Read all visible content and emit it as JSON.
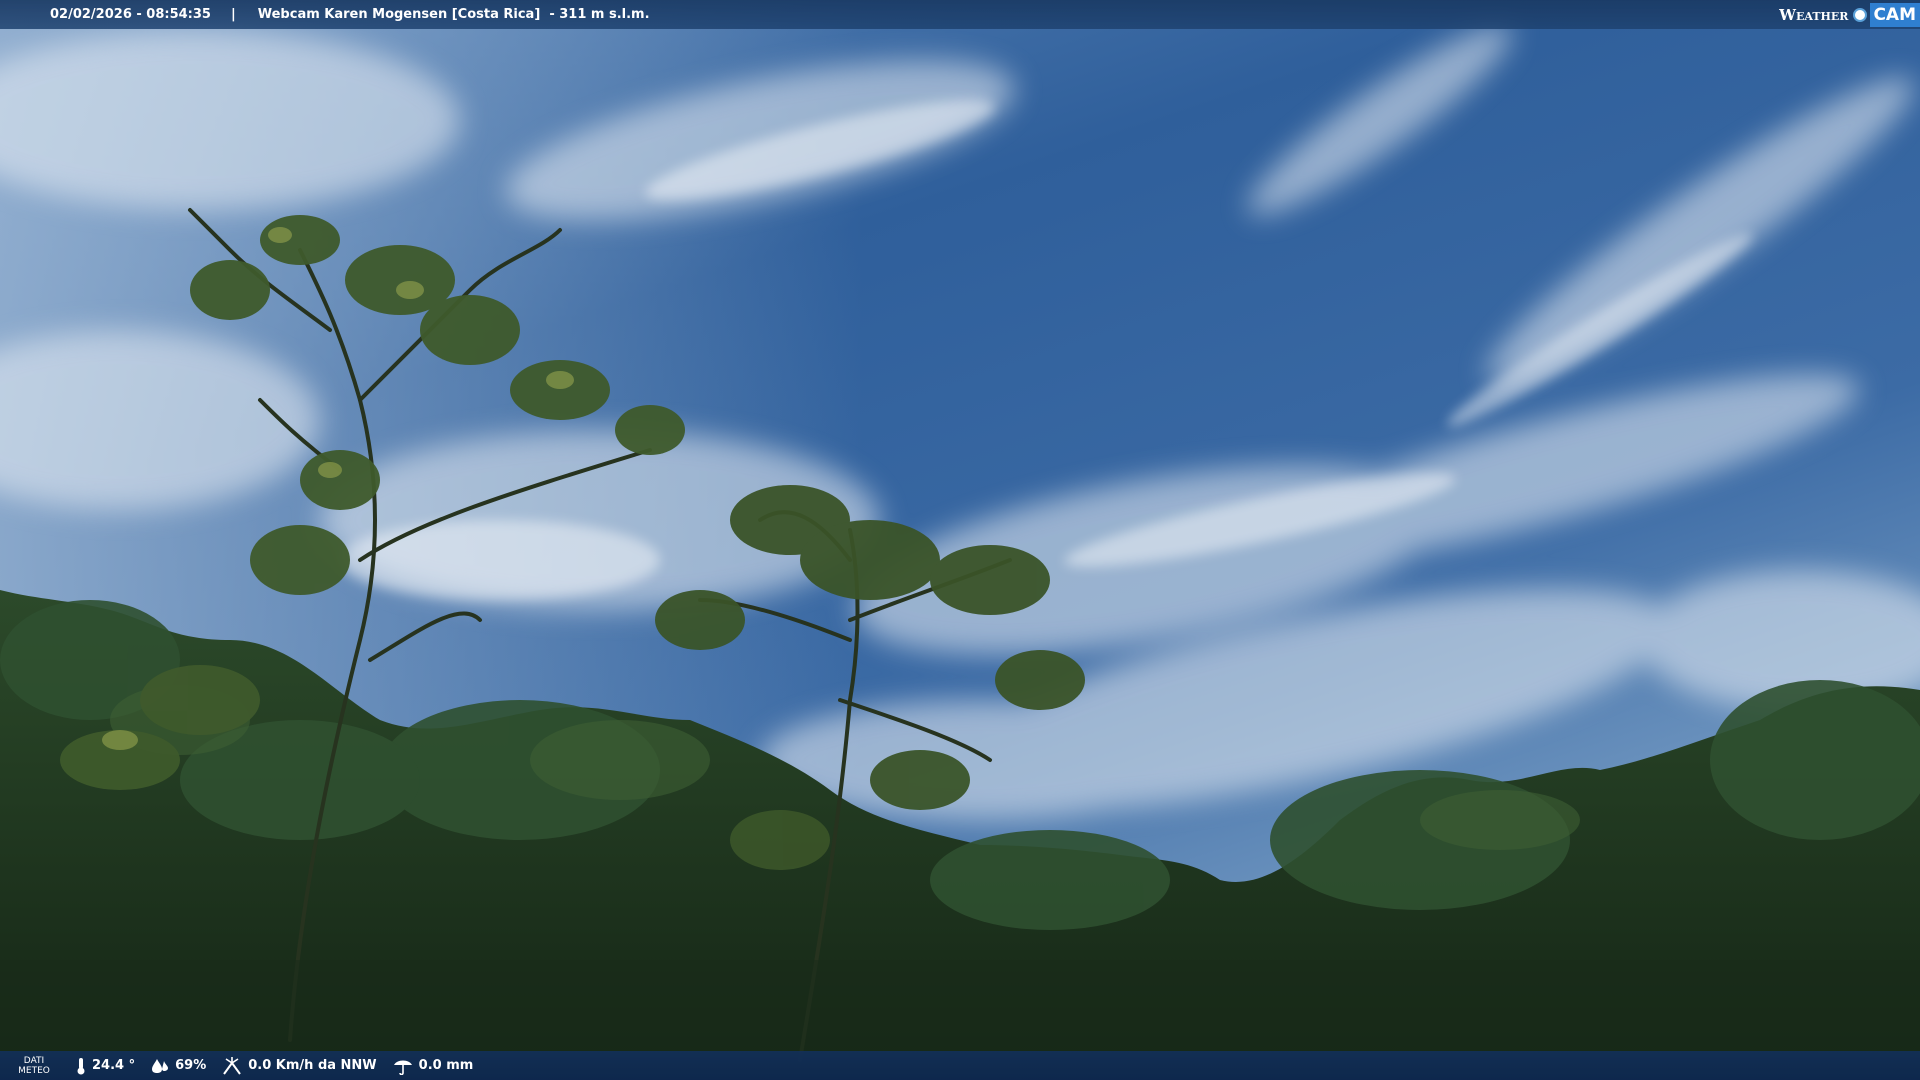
{
  "header": {
    "timestamp": "02/02/2026 - 08:54:35",
    "separator": "|",
    "camera_title": "Webcam Karen Mogensen [Costa Rica]  - 311 m s.l.m.",
    "logo_word": "Weather",
    "logo_cam": "CAM"
  },
  "footer": {
    "meteo_line1": "DATI",
    "meteo_line2": "METEO",
    "temperature": "24.4 °",
    "humidity": "69%",
    "wind": "0.0 Km/h da NNW",
    "rain": "0.0 mm"
  },
  "icons": [
    "thermometer-icon",
    "humidity-drop-icon",
    "wind-icon",
    "rain-icon"
  ],
  "colors": {
    "bar": "#1c3f6e",
    "sky_top": "#2a5a97",
    "sky_bottom": "#6f97bf",
    "foliage": "#1f3a22"
  }
}
